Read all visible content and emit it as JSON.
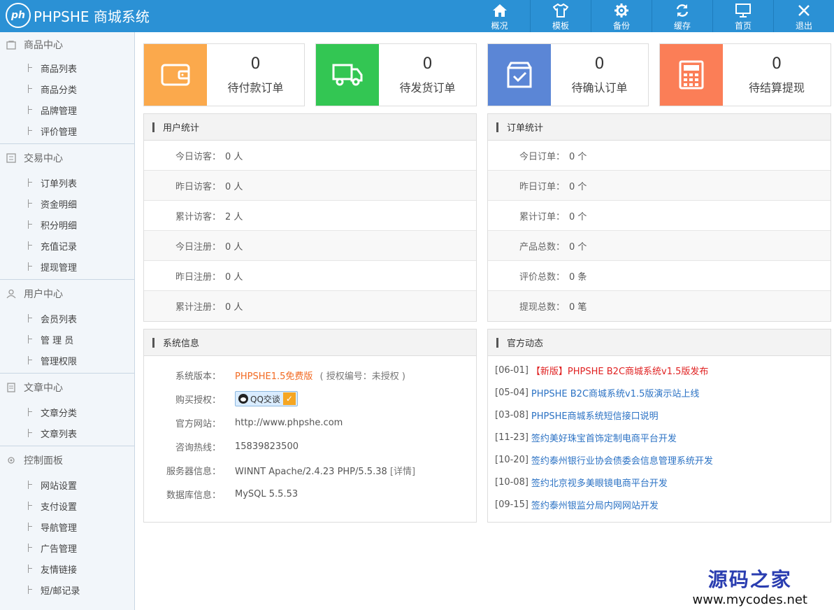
{
  "header": {
    "logo_mark": "ph",
    "logo_text": "PHPSHE 商城系统",
    "nav": [
      {
        "label": "概况",
        "icon": "home-icon"
      },
      {
        "label": "模板",
        "icon": "shirt-icon"
      },
      {
        "label": "备份",
        "icon": "gear-icon"
      },
      {
        "label": "缓存",
        "icon": "refresh-icon"
      },
      {
        "label": "首页",
        "icon": "monitor-icon"
      },
      {
        "label": "退出",
        "icon": "close-icon"
      }
    ]
  },
  "sidebar": {
    "sections": [
      {
        "title": "商品中心",
        "icon": "bag-icon",
        "items": [
          "商品列表",
          "商品分类",
          "品牌管理",
          "评价管理"
        ]
      },
      {
        "title": "交易中心",
        "icon": "list-icon",
        "items": [
          "订单列表",
          "资金明细",
          "积分明细",
          "充值记录",
          "提现管理"
        ]
      },
      {
        "title": "用户中心",
        "icon": "user-icon",
        "items": [
          "会员列表",
          "管 理 员",
          "管理权限"
        ]
      },
      {
        "title": "文章中心",
        "icon": "doc-icon",
        "items": [
          "文章分类",
          "文章列表"
        ]
      },
      {
        "title": "控制面板",
        "icon": "settings-icon",
        "items": [
          "网站设置",
          "支付设置",
          "导航管理",
          "广告管理",
          "友情链接",
          "短/邮记录"
        ]
      }
    ]
  },
  "cards": [
    {
      "value": "0",
      "label": "待付款订单",
      "color": "#fba94c",
      "icon": "wallet-icon"
    },
    {
      "value": "0",
      "label": "待发货订单",
      "color": "#33c653",
      "icon": "truck-icon"
    },
    {
      "value": "0",
      "label": "待确认订单",
      "color": "#5b86d6",
      "icon": "box-check-icon"
    },
    {
      "value": "0",
      "label": "待结算提现",
      "color": "#fb7e57",
      "icon": "calculator-icon"
    }
  ],
  "user_stats": {
    "title": "用户统计",
    "rows": [
      {
        "k": "今日访客：",
        "v": "0 人"
      },
      {
        "k": "昨日访客：",
        "v": "0 人"
      },
      {
        "k": "累计访客：",
        "v": "2 人"
      },
      {
        "k": "今日注册：",
        "v": "0 人"
      },
      {
        "k": "昨日注册：",
        "v": "0 人"
      },
      {
        "k": "累计注册：",
        "v": "0 人"
      }
    ]
  },
  "order_stats": {
    "title": "订单统计",
    "rows": [
      {
        "k": "今日订单：",
        "v": "0 个"
      },
      {
        "k": "昨日订单：",
        "v": "0 个"
      },
      {
        "k": "累计订单：",
        "v": "0 个"
      },
      {
        "k": "产品总数：",
        "v": "0 个"
      },
      {
        "k": "评价总数：",
        "v": "0 条"
      },
      {
        "k": "提现总数：",
        "v": "0 笔"
      }
    ]
  },
  "system_info": {
    "title": "系统信息",
    "version_label": "系统版本：",
    "version": "PHPSHE1.5免费版",
    "license": "( 授权编号：未授权 )",
    "buy_label": "购买授权：",
    "qq_label": "QQ交谈",
    "site_label": "官方网站：",
    "site": "http://www.phpshe.com",
    "hotline_label": "咨询热线：",
    "hotline": "15839823500",
    "server_label": "服务器信息：",
    "server": "WINNT Apache/2.4.23 PHP/5.5.38",
    "server_detail": "[详情]",
    "db_label": "数据库信息：",
    "db": "MySQL 5.5.53"
  },
  "news": {
    "title": "官方动态",
    "items": [
      {
        "date": "[06-01]",
        "text": "【新版】PHPSHE B2C商城系统v1.5版发布",
        "highlight": true
      },
      {
        "date": "[05-04]",
        "text": "PHPSHE B2C商城系统v1.5版演示站上线",
        "highlight": false
      },
      {
        "date": "[03-08]",
        "text": "PHPSHE商城系统短信接口说明",
        "highlight": false
      },
      {
        "date": "[11-23]",
        "text": "签约美好珠宝首饰定制电商平台开发",
        "highlight": false
      },
      {
        "date": "[10-20]",
        "text": "签约泰州银行业协会债委会信息管理系统开发",
        "highlight": false
      },
      {
        "date": "[10-08]",
        "text": "签约北京视多美眼镜电商平台开发",
        "highlight": false
      },
      {
        "date": "[09-15]",
        "text": "签约泰州银监分局内网网站开发",
        "highlight": false
      }
    ]
  },
  "watermark": {
    "line1": "源码之家",
    "line2": "www.mycodes.net"
  }
}
